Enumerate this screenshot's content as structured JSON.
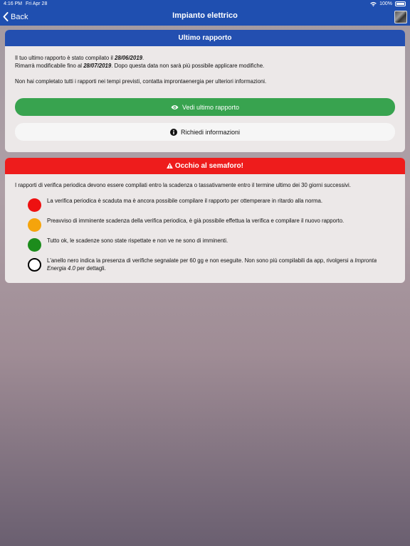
{
  "status_bar": {
    "time": "4:16 PM",
    "date": "Fri Apr 28",
    "battery": "100%"
  },
  "nav": {
    "back_label": "Back",
    "title": "Impianto elettrico",
    "icons": {
      "back": "chevron-left-icon",
      "avatar": "user-avatar"
    }
  },
  "report_card": {
    "title": "Ultimo rapporto",
    "line1_prefix": "Il tuo ultimo rapporto è stato compilato il ",
    "line1_date": "28/06/2019",
    "line1_suffix": ".",
    "line2_prefix": "Rimarrà modificabile fino al ",
    "line2_date": "28/07/2019",
    "line2_suffix": ". Dopo questa data non sarà più possibile applicare modifiche.",
    "line3": "Non hai completato tutti i rapporti nei tempi previsti, contatta improntaenergia per ulteriori informazioni.",
    "view_button": "Vedi ultimo rapporto",
    "info_button": "Richiedi informazioni",
    "view_icon": "eye-icon",
    "info_icon": "info-icon"
  },
  "semaphore_card": {
    "title": "Occhio al semaforo!",
    "title_icon": "warning-icon",
    "intro": "I rapporti di verifica periodica devono essere compilati entro la scadenza o tassativamente entro il termine ultimo dei 30 giorni successivi.",
    "legend": [
      {
        "color": "#ee1111",
        "text": "La verifica periodica è scaduta ma è ancora possibile compilare il rapporto per ottemperare in ritardo alla norma."
      },
      {
        "color": "#f5a40c",
        "text": "Preavviso di imminente scadenza della verifica periodica, è già possibile effettua la verifica e compilare il nuovo rapporto."
      },
      {
        "color": "#1c8c1c",
        "text": "Tutto ok, le scadenze sono state rispettate e non ve ne sono di imminenti."
      },
      {
        "color": "#ffffff",
        "ring": "#000000",
        "text_prefix": "L'anello nero indica la presenza di verifiche segnalate per 60 gg e non eseguite. Non sono più compilabili da app, rivolgersi a ",
        "text_em": "Impronta Energia 4.0",
        "text_suffix": " per dettagli."
      }
    ]
  },
  "colors": {
    "header": "#1f4fb0",
    "card_title_blue": "#234fb0",
    "card_title_red": "#ee1c1c",
    "button_green": "#38a34f"
  }
}
